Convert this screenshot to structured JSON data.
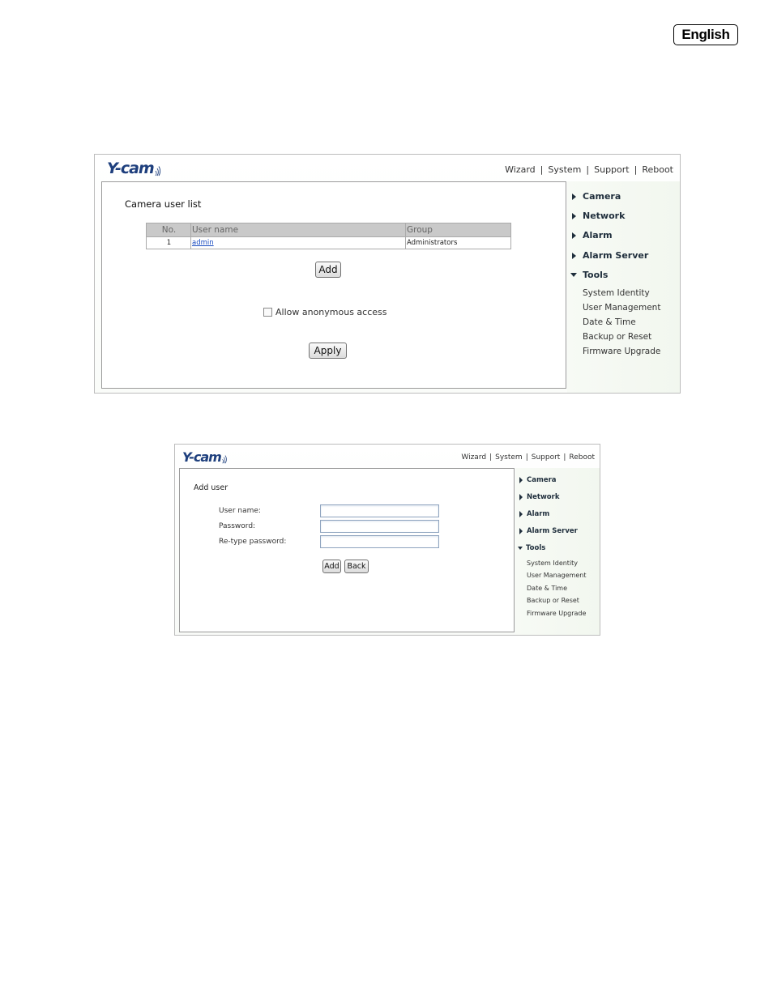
{
  "language_badge": "English",
  "shot1": {
    "logo": "Y-cam",
    "top_nav": [
      "Wizard",
      "System",
      "Support",
      "Reboot"
    ],
    "title": "Camera user list",
    "table": {
      "headers": [
        "No.",
        "User name",
        "Group"
      ],
      "rows": [
        {
          "no": "1",
          "user": "admin",
          "group": "Administrators"
        }
      ]
    },
    "add_button": "Add",
    "anonymous_label": "Allow anonymous access",
    "apply_button": "Apply",
    "sidebar": {
      "items": [
        "Camera",
        "Network",
        "Alarm",
        "Alarm Server",
        "Tools"
      ],
      "tools_sub": [
        "System Identity",
        "User Management",
        "Date & Time",
        "Backup or Reset",
        "Firmware Upgrade"
      ]
    }
  },
  "shot2": {
    "logo": "Y-cam",
    "top_nav": [
      "Wizard",
      "System",
      "Support",
      "Reboot"
    ],
    "title": "Add user",
    "fields": [
      "User name:",
      "Password:",
      "Re-type password:"
    ],
    "add_button": "Add",
    "back_button": "Back",
    "sidebar": {
      "items": [
        "Camera",
        "Network",
        "Alarm",
        "Alarm Server",
        "Tools"
      ],
      "tools_sub": [
        "System Identity",
        "User Management",
        "Date & Time",
        "Backup or Reset",
        "Firmware Upgrade"
      ]
    }
  },
  "colors": {
    "logo": "#1e3f7d",
    "link": "#1a4cc0",
    "table_header": "#c9c9c9",
    "sidebar_bg": "#f4f8f1"
  }
}
